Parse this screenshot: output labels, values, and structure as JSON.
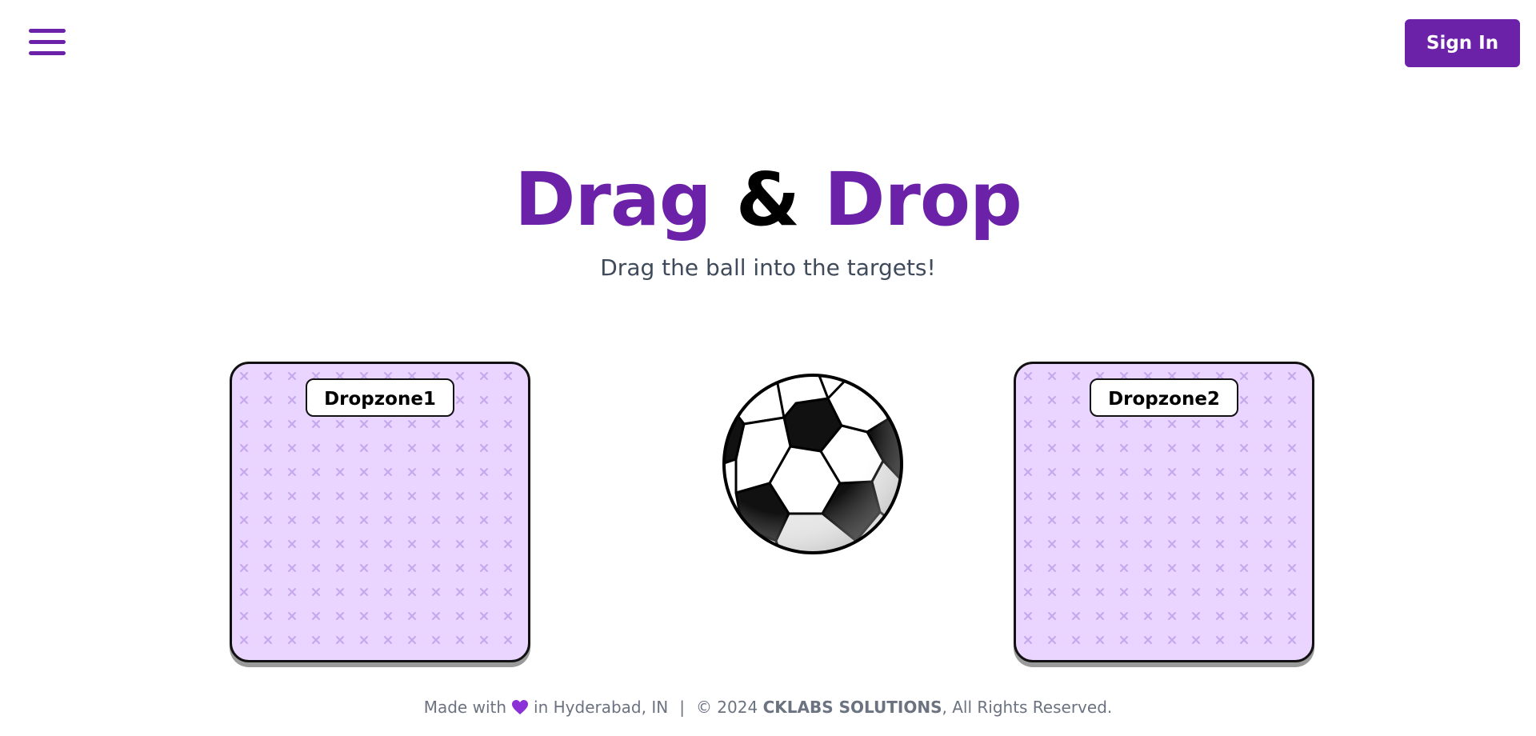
{
  "header": {
    "menu_icon": "hamburger-menu-icon",
    "signin_label": "Sign In"
  },
  "hero": {
    "title_part1": "Drag",
    "title_amp": "&",
    "title_part2": "Drop",
    "subtitle": "Drag the ball into the targets!"
  },
  "dropzones": [
    {
      "label": "Dropzone1"
    },
    {
      "label": "Dropzone2"
    }
  ],
  "ball": {
    "icon": "soccer-ball-icon"
  },
  "footer": {
    "made_with": "Made with",
    "heart_icon": "purple-heart-icon",
    "location": "in Hyderabad, IN",
    "separator": "|",
    "copyright": "© 2024",
    "company": "CKLABS SOLUTIONS",
    "rights": ", All Rights Reserved."
  },
  "colors": {
    "brand": "#6b21a8",
    "dropzone_bg": "#e9d5ff",
    "subtitle": "#3f4a5a",
    "footer_text": "#6b7280"
  }
}
